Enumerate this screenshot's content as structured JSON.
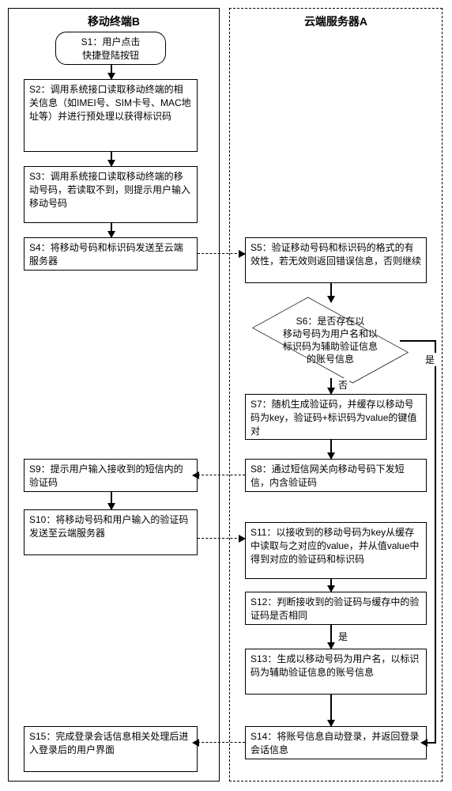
{
  "lanes": {
    "left": "移动终端B",
    "right": "云端服务器A"
  },
  "steps": {
    "s1": "S1：用户点击\n快捷登陆按钮",
    "s2": "S2：调用系统接口读取移动终端的相关信息（如IMEI号、SIM卡号、MAC地址等）并进行预处理以获得标识码",
    "s3": "S3：调用系统接口读取移动终端的移动号码，若读取不到，则提示用户输入移动号码",
    "s4": "S4：将移动号码和标识码发送至云端服务器",
    "s5": "S5：验证移动号码和标识码的格式的有效性，若无效则返回错误信息，否则继续",
    "s6": "S6：是否存在以\n移动号码为用户名和以\n标识码为辅助验证信息\n的账号信息",
    "s7": "S7：随机生成验证码，并缓存以移动号码为key，验证码+标识码为value的键值对",
    "s8": "S8：通过短信网关向移动号码下发短信，内含验证码",
    "s9": "S9：提示用户输入接收到的短信内的验证码",
    "s10": "S10：将移动号码和用户输入的验证码发送至云端服务器",
    "s11": "S11：以接收到的移动号码为key从缓存中读取与之对应的value，并从值value中得到对应的验证码和标识码",
    "s12": "S12：判断接收到的验证码与缓存中的验证码是否相同",
    "s13": "S13：生成以移动号码为用户名，以标识码为辅助验证信息的账号信息",
    "s14": "S14：将账号信息自动登录，并返回登录会话信息",
    "s15": "S15：完成登录会话信息相关处理后进入登录后的用户界面"
  },
  "labels": {
    "no": "否",
    "yes": "是",
    "yes2": "是"
  }
}
